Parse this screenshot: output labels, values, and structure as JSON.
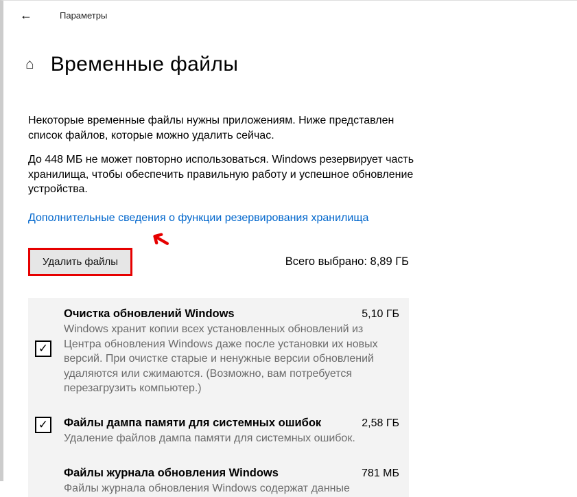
{
  "topbar": {
    "title": "Параметры"
  },
  "header": {
    "title": "Временные файлы"
  },
  "description1": "Некоторые временные файлы нужны приложениям. Ниже представлен список файлов, которые можно удалить сейчас.",
  "description2": "До 448 МБ не может повторно использоваться. Windows резервирует часть хранилища, чтобы обеспечить правильную работу и успешное обновление устройства.",
  "link_text": "Дополнительные сведения о функции резервирования хранилища",
  "delete_button": "Удалить файлы",
  "selected_total": "Всего выбрано: 8,89 ГБ",
  "items": [
    {
      "title": "Очистка обновлений Windows",
      "size": "5,10 ГБ",
      "desc": "Windows хранит копии всех установленных обновлений из Центра обновления Windows даже после установки их новых версий. При очистке старые и ненужные версии обновлений удаляются или сжимаются. (Возможно, вам потребуется перезагрузить компьютер.)",
      "checked": true
    },
    {
      "title": "Файлы дампа памяти для системных ошибок",
      "size": "2,58 ГБ",
      "desc": "Удаление файлов дампа памяти для системных ошибок.",
      "checked": true
    },
    {
      "title": "Файлы журнала обновления Windows",
      "size": "781 МБ",
      "desc": "Файлы журнала обновления Windows содержат данные",
      "checked": false
    }
  ]
}
